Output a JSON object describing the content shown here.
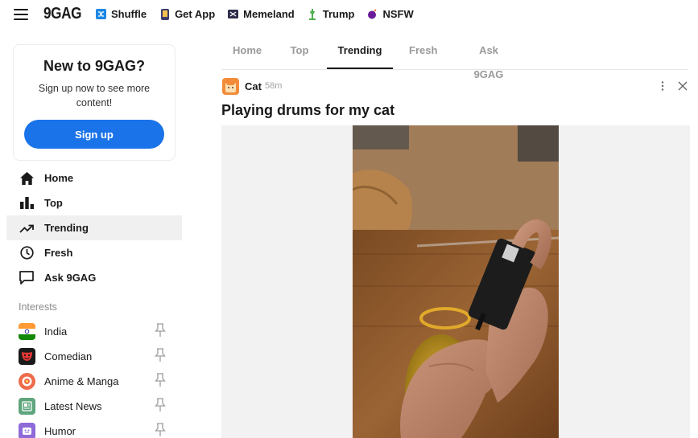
{
  "header": {
    "logo": "9GAG",
    "nav": [
      {
        "label": "Shuffle",
        "icon": "shuffle-icon",
        "color": "#1e88e5"
      },
      {
        "label": "Get App",
        "icon": "phone-icon",
        "color": "#3c3c6e"
      },
      {
        "label": "Memeland",
        "icon": "memeland-icon",
        "color": "#2e2e4a"
      },
      {
        "label": "Trump",
        "icon": "statue-of-liberty-icon",
        "color": "#4caf50"
      },
      {
        "label": "NSFW",
        "icon": "bomb-icon",
        "color": "#6a1b9a"
      }
    ]
  },
  "promo": {
    "title": "New to 9GAG?",
    "text": "Sign up now to see more content!",
    "button": "Sign up",
    "button_color": "#1a73e8"
  },
  "sidebar": {
    "items": [
      {
        "label": "Home",
        "icon": "home-icon"
      },
      {
        "label": "Top",
        "icon": "bar-chart-icon"
      },
      {
        "label": "Trending",
        "icon": "trending-icon",
        "active": true
      },
      {
        "label": "Fresh",
        "icon": "clock-icon"
      },
      {
        "label": "Ask 9GAG",
        "icon": "chat-bubble-icon"
      }
    ],
    "interests_heading": "Interests",
    "interests": [
      {
        "label": "India",
        "icon": "india-flag-icon"
      },
      {
        "label": "Comedian",
        "icon": "comedian-icon"
      },
      {
        "label": "Anime & Manga",
        "icon": "anime-icon"
      },
      {
        "label": "Latest News",
        "icon": "news-icon"
      },
      {
        "label": "Humor",
        "icon": "humor-icon"
      }
    ]
  },
  "tabs": [
    "Home",
    "Top",
    "Trending",
    "Fresh",
    "Ask 9GAG"
  ],
  "active_tab": "Trending",
  "post": {
    "section": "Cat",
    "time": "58m",
    "title": "Playing drums for my cat"
  }
}
